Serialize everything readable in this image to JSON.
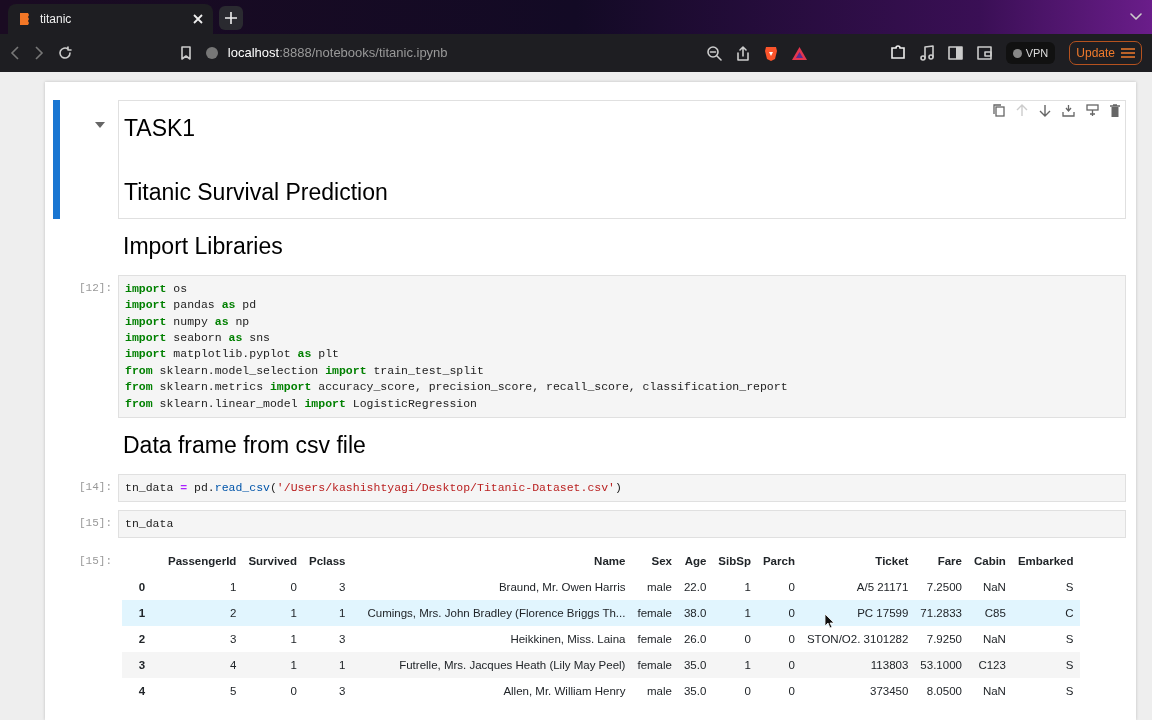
{
  "browser": {
    "tab": {
      "title": "titanic",
      "selected": true
    },
    "url": {
      "host": "localhost",
      "path": ":8888/notebooks/titanic.ipynb"
    },
    "vpn_label": "VPN",
    "update_label": "Update"
  },
  "cells": [
    {
      "kind": "markdown",
      "selected": true,
      "collapsible": true,
      "headings": [
        "TASK1",
        "Titanic Survival Prediction"
      ]
    },
    {
      "kind": "markdown",
      "selected": false,
      "headings": [
        "Import Libraries"
      ]
    },
    {
      "kind": "code",
      "prompt": "[12]:",
      "lines": [
        [
          {
            "t": "import",
            "kind": "keyword"
          },
          {
            "t": " os",
            "kind": "plain"
          }
        ],
        [
          {
            "t": "import",
            "kind": "keyword"
          },
          {
            "t": " pandas ",
            "kind": "plain"
          },
          {
            "t": "as",
            "kind": "keyword"
          },
          {
            "t": " pd",
            "kind": "plain"
          }
        ],
        [
          {
            "t": "import",
            "kind": "keyword"
          },
          {
            "t": " numpy ",
            "kind": "plain"
          },
          {
            "t": "as",
            "kind": "keyword"
          },
          {
            "t": " np",
            "kind": "plain"
          }
        ],
        [
          {
            "t": "import",
            "kind": "keyword"
          },
          {
            "t": " seaborn ",
            "kind": "plain"
          },
          {
            "t": "as",
            "kind": "keyword"
          },
          {
            "t": " sns",
            "kind": "plain"
          }
        ],
        [
          {
            "t": "import",
            "kind": "keyword"
          },
          {
            "t": " matplotlib.pyplot ",
            "kind": "plain"
          },
          {
            "t": "as",
            "kind": "keyword"
          },
          {
            "t": " plt",
            "kind": "plain"
          }
        ],
        [
          {
            "t": "from",
            "kind": "keyword"
          },
          {
            "t": " sklearn.model_selection ",
            "kind": "plain"
          },
          {
            "t": "import",
            "kind": "keyword"
          },
          {
            "t": " train_test_split",
            "kind": "plain"
          }
        ],
        [
          {
            "t": "from",
            "kind": "keyword"
          },
          {
            "t": " sklearn.metrics ",
            "kind": "plain"
          },
          {
            "t": "import",
            "kind": "keyword"
          },
          {
            "t": " accuracy_score, precision_score, recall_score, classification_report",
            "kind": "plain"
          }
        ],
        [
          {
            "t": "from",
            "kind": "keyword"
          },
          {
            "t": " sklearn.linear_model ",
            "kind": "plain"
          },
          {
            "t": "import",
            "kind": "keyword"
          },
          {
            "t": " LogisticRegression",
            "kind": "plain"
          }
        ]
      ]
    },
    {
      "kind": "markdown",
      "selected": false,
      "headings": [
        "Data frame from csv file"
      ]
    },
    {
      "kind": "code",
      "prompt": "[14]:",
      "lines": [
        [
          {
            "t": "tn_data ",
            "kind": "plain"
          },
          {
            "t": "=",
            "kind": "operator"
          },
          {
            "t": " pd.",
            "kind": "plain"
          },
          {
            "t": "read_csv",
            "kind": "function"
          },
          {
            "t": "(",
            "kind": "plain"
          },
          {
            "t": "'/Users/kashishtyagi/Desktop/Titanic-Dataset.csv'",
            "kind": "string"
          },
          {
            "t": ")",
            "kind": "plain"
          }
        ]
      ]
    },
    {
      "kind": "code",
      "prompt": "[15]:",
      "lines": [
        [
          {
            "t": "tn_data",
            "kind": "plain"
          }
        ]
      ]
    },
    {
      "kind": "output",
      "prompt": "[15]:",
      "table": {
        "columns": [
          "",
          "PassengerId",
          "Survived",
          "Pclass",
          "Name",
          "Sex",
          "Age",
          "SibSp",
          "Parch",
          "Ticket",
          "Fare",
          "Cabin",
          "Embarked"
        ],
        "rows": [
          {
            "hovered": false,
            "cells": [
              "0",
              "1",
              "0",
              "3",
              "Braund, Mr. Owen Harris",
              "male",
              "22.0",
              "1",
              "0",
              "A/5 21171",
              "7.2500",
              "NaN",
              "S"
            ]
          },
          {
            "hovered": true,
            "cells": [
              "1",
              "2",
              "1",
              "1",
              "Cumings, Mrs. John Bradley (Florence Briggs Th...",
              "female",
              "38.0",
              "1",
              "0",
              "PC 17599",
              "71.2833",
              "C85",
              "C"
            ]
          },
          {
            "hovered": false,
            "cells": [
              "2",
              "3",
              "1",
              "3",
              "Heikkinen, Miss. Laina",
              "female",
              "26.0",
              "0",
              "0",
              "STON/O2. 3101282",
              "7.9250",
              "NaN",
              "S"
            ]
          },
          {
            "hovered": false,
            "cells": [
              "3",
              "4",
              "1",
              "1",
              "Futrelle, Mrs. Jacques Heath (Lily May Peel)",
              "female",
              "35.0",
              "1",
              "0",
              "113803",
              "53.1000",
              "C123",
              "S"
            ]
          },
          {
            "hovered": false,
            "cells": [
              "4",
              "5",
              "0",
              "3",
              "Allen, Mr. William Henry",
              "male",
              "35.0",
              "0",
              "0",
              "373450",
              "8.0500",
              "NaN",
              "S"
            ]
          }
        ]
      }
    }
  ]
}
